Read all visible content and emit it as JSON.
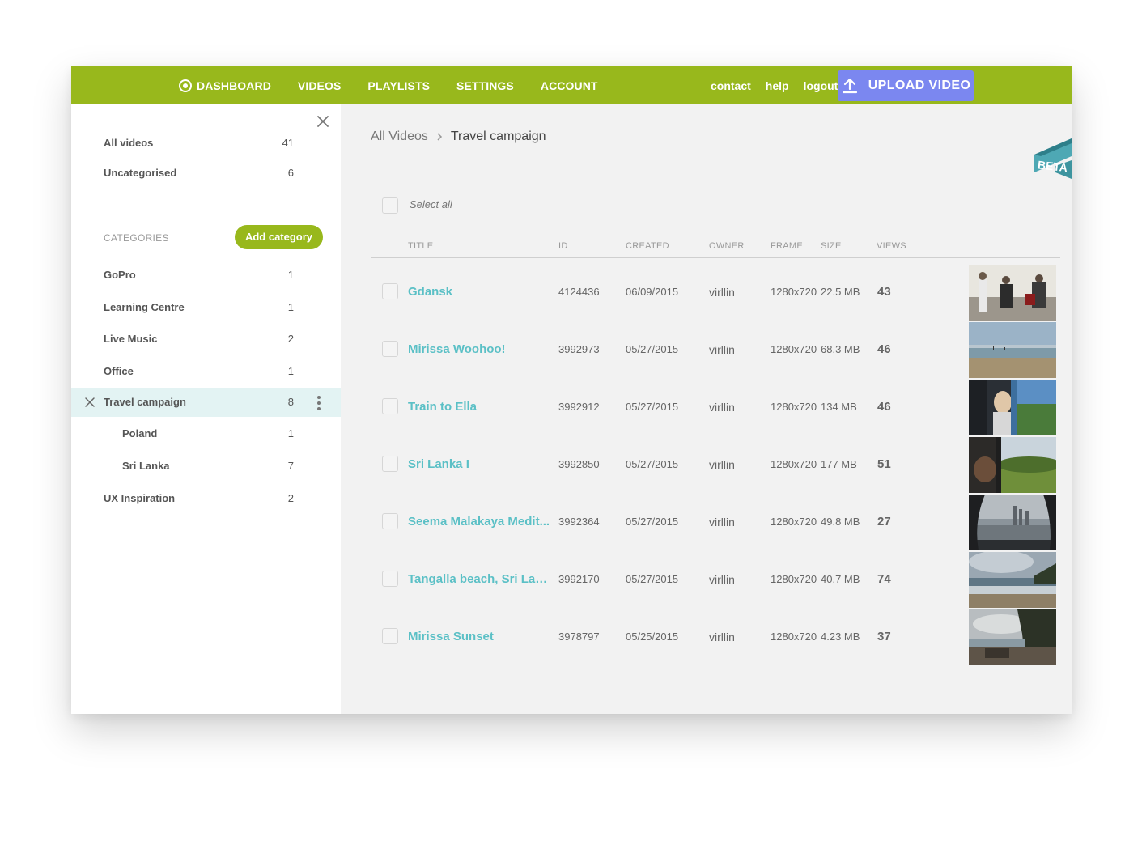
{
  "nav": {
    "items": [
      "DASHBOARD",
      "VIDEOS",
      "PLAYLISTS",
      "SETTINGS",
      "ACCOUNT"
    ],
    "links": [
      "contact",
      "help",
      "logout"
    ],
    "upload_label": "UPLOAD VIDEO"
  },
  "sidebar": {
    "all_videos": {
      "label": "All videos",
      "count": "41"
    },
    "uncategorised": {
      "label": "Uncategorised",
      "count": "6"
    },
    "categories_heading": "CATEGORIES",
    "add_category": "Add category",
    "categories": [
      {
        "label": "GoPro",
        "count": "1"
      },
      {
        "label": "Learning Centre",
        "count": "1"
      },
      {
        "label": "Live Music",
        "count": "2"
      },
      {
        "label": "Office",
        "count": "1"
      },
      {
        "label": "Travel campaign",
        "count": "8",
        "active": true
      },
      {
        "label": "Poland",
        "count": "1",
        "sub": true
      },
      {
        "label": "Sri Lanka",
        "count": "7",
        "sub": true
      },
      {
        "label": "UX Inspiration",
        "count": "2"
      }
    ]
  },
  "breadcrumb": {
    "root": "All Videos",
    "current": "Travel campaign"
  },
  "beta_label": "BETA",
  "select_all": "Select all",
  "table": {
    "headers": {
      "title": "TITLE",
      "id": "ID",
      "created": "CREATED",
      "owner": "OWNER",
      "frame": "FRAME",
      "size": "SIZE",
      "views": "VIEWS"
    },
    "rows": [
      {
        "title": "Gdansk",
        "id": "4124436",
        "created": "06/09/2015",
        "owner": "virllin",
        "frame": "1280x720",
        "size": "22.5 MB",
        "views": "43"
      },
      {
        "title": "Mirissa Woohoo!",
        "id": "3992973",
        "created": "05/27/2015",
        "owner": "virllin",
        "frame": "1280x720",
        "size": "68.3 MB",
        "views": "46"
      },
      {
        "title": "Train to Ella",
        "id": "3992912",
        "created": "05/27/2015",
        "owner": "virllin",
        "frame": "1280x720",
        "size": "134 MB",
        "views": "46"
      },
      {
        "title": "Sri Lanka I",
        "id": "3992850",
        "created": "05/27/2015",
        "owner": "virllin",
        "frame": "1280x720",
        "size": "177 MB",
        "views": "51"
      },
      {
        "title": "Seema Malakaya Medit...",
        "id": "3992364",
        "created": "05/27/2015",
        "owner": "virllin",
        "frame": "1280x720",
        "size": "49.8 MB",
        "views": "27"
      },
      {
        "title": "Tangalla beach, Sri Lanka",
        "id": "3992170",
        "created": "05/27/2015",
        "owner": "virllin",
        "frame": "1280x720",
        "size": "40.7 MB",
        "views": "74"
      },
      {
        "title": "Mirissa Sunset",
        "id": "3978797",
        "created": "05/25/2015",
        "owner": "virllin",
        "frame": "1280x720",
        "size": "4.23 MB",
        "views": "37"
      }
    ]
  },
  "colors": {
    "brand": "#98b81c",
    "upload": "#7b87f0",
    "title_link": "#5bc0c6",
    "active_row": "#e3f3f3",
    "beta": "#4ea8b4"
  }
}
